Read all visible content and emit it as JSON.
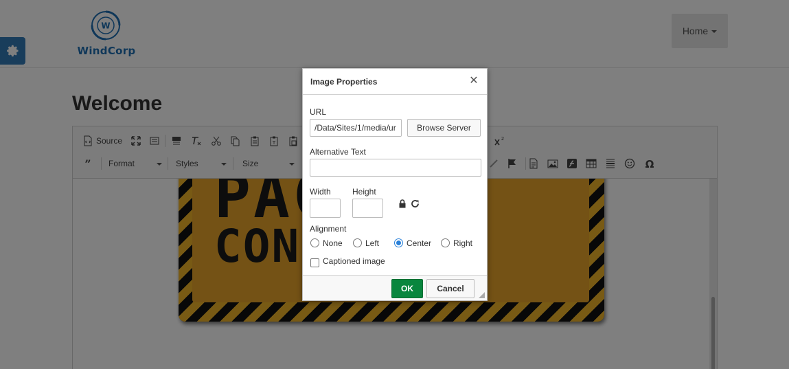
{
  "brand": {
    "name": "WindCorp",
    "mark_letter": "W",
    "color": "#1f6fb2"
  },
  "nav": {
    "home_label": "Home"
  },
  "page": {
    "title": "Welcome"
  },
  "toolbar": {
    "source_label": "Source",
    "format_label": "Format",
    "styles_label": "Styles",
    "size_label": "Size",
    "row1_icons": [
      "source-icon",
      "maximize-icon",
      "show-blocks-icon",
      "paste-text-icon",
      "remove-format-icon",
      "cut-icon",
      "copy-icon",
      "paste-icon",
      "paste-plain-icon",
      "paste-word-icon",
      "superscript-icon"
    ],
    "row2_icons": [
      "blockquote-icon",
      "anchor-icon",
      "flag-icon",
      "document-icon",
      "image-icon",
      "flash-icon",
      "table-icon",
      "horizontal-rule-icon",
      "smiley-icon",
      "omega-icon"
    ]
  },
  "content": {
    "sign_line1": "PAC    DER",
    "sign_line2": "CON      ION"
  },
  "dialog": {
    "title": "Image Properties",
    "url_label": "URL",
    "url_value": "/Data/Sites/1/media/ur",
    "browse_label": "Browse Server",
    "alt_label": "Alternative Text",
    "alt_value": "",
    "width_label": "Width",
    "width_value": "",
    "height_label": "Height",
    "height_value": "",
    "alignment_label": "Alignment",
    "align_options": [
      {
        "label": "None",
        "checked": false
      },
      {
        "label": "Left",
        "checked": false
      },
      {
        "label": "Center",
        "checked": true
      },
      {
        "label": "Right",
        "checked": false
      }
    ],
    "captioned_label": "Captioned image",
    "captioned_checked": false,
    "ok_label": "OK",
    "cancel_label": "Cancel"
  },
  "colors": {
    "ok_green": "#09863e",
    "radio_blue": "#2980d9",
    "settings_blue": "#337ab7"
  }
}
